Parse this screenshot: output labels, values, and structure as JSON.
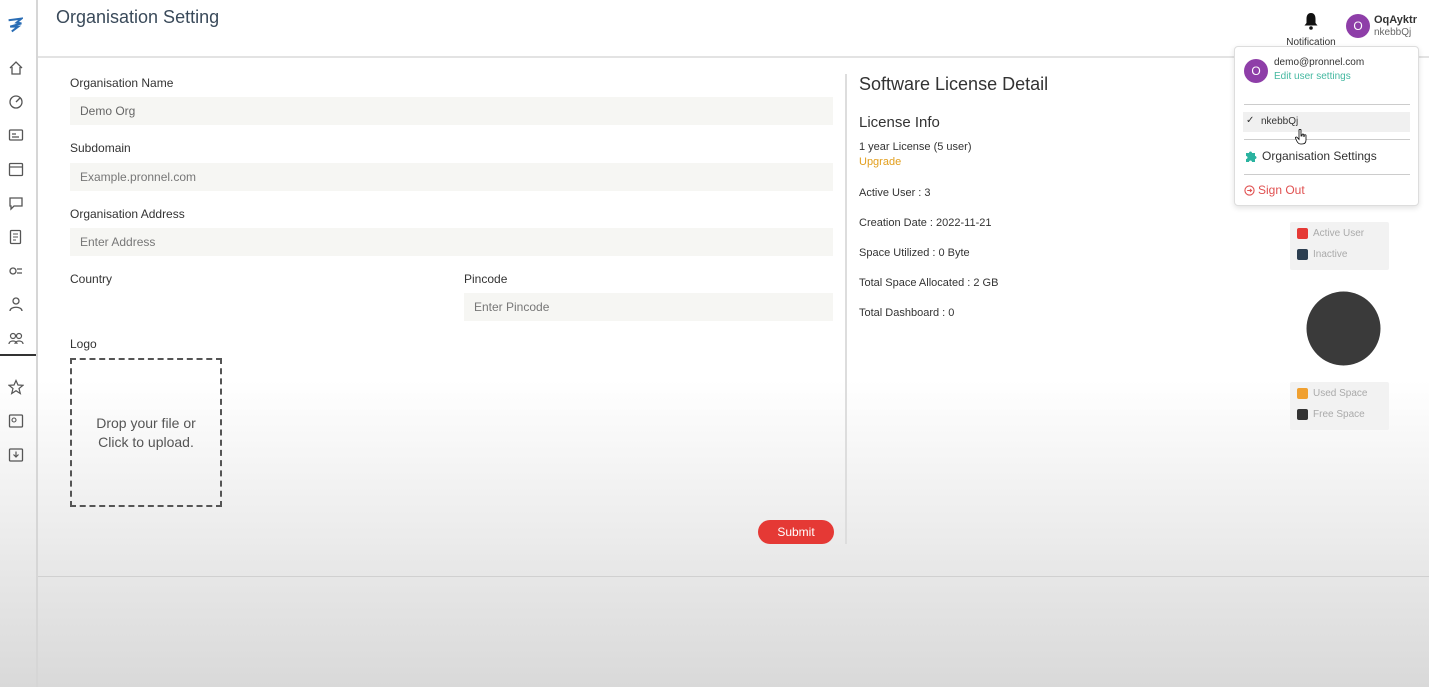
{
  "header": {
    "title": "Organisation Setting",
    "notification_label": "Notification",
    "user": {
      "avatar_initial": "O",
      "name": "OqAyktr",
      "org": "nkebbQj"
    }
  },
  "form": {
    "org_name": {
      "label": "Organisation Name",
      "value": "Demo Org"
    },
    "subdomain": {
      "label": "Subdomain",
      "placeholder": "Example.pronnel.com"
    },
    "address": {
      "label": "Organisation Address",
      "placeholder": "Enter Address"
    },
    "country": {
      "label": "Country"
    },
    "pincode": {
      "label": "Pincode",
      "placeholder": "Enter Pincode"
    },
    "logo": {
      "label": "Logo",
      "upload_line1": "Drop your file or",
      "upload_line2": "Click to upload."
    },
    "submit_label": "Submit"
  },
  "license": {
    "title": "Software License Detail",
    "subtitle": "License Info",
    "plan": "1 year License (5 user)",
    "upgrade_label": "Upgrade",
    "active_user": "Active User : 3",
    "creation_date": "Creation Date : 2022-11-21",
    "space_utilized": "Space Utilized : 0 Byte",
    "total_space": "Total Space Allocated : 2 GB",
    "total_dashboard": "Total Dashboard : 0"
  },
  "legends": {
    "users": [
      {
        "label": "Active User",
        "color": "#e53935"
      },
      {
        "label": "Inactive",
        "color": "#2c3e50"
      }
    ],
    "space": [
      {
        "label": "Used Space",
        "color": "#f0a030"
      },
      {
        "label": "Free Space",
        "color": "#333333"
      }
    ]
  },
  "dropdown": {
    "avatar_initial": "O",
    "email": "demo@pronnel.com",
    "edit_label": "Edit user settings",
    "org_item": "nkebbQj",
    "org_settings_label": "Organisation Settings",
    "sign_out_label": "Sign Out"
  },
  "colors": {
    "accent_red": "#e53935",
    "avatar_purple": "#8e3ea8",
    "link_teal": "#44b8a0",
    "upgrade_orange": "#e29e1c"
  }
}
